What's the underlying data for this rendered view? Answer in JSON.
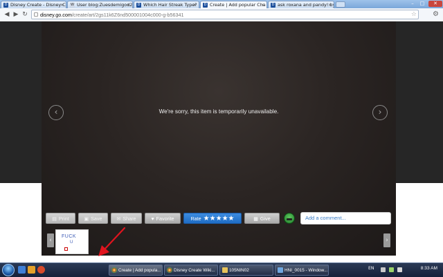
{
  "browser": {
    "tabs": [
      {
        "label": "Disney Create - Disney Cr",
        "icon": "disney-icon",
        "active": false
      },
      {
        "label": "User blog:Zuesdemigod2",
        "icon": "wiki-icon",
        "active": false
      },
      {
        "label": "Which Hair Streak Type? ·",
        "icon": "disney-icon",
        "active": false
      },
      {
        "label": "Create | Add popular Cha",
        "icon": "disney-icon",
        "active": true
      },
      {
        "label": "ask roxana and pandy! by",
        "icon": "disney-icon",
        "active": false
      }
    ],
    "url_host": "disney.go.com",
    "url_path": "/create/art/2gs11k6Z6nd500001004c000-g-b56341"
  },
  "viewer": {
    "message": "We're sorry, this item is temporarily unavailable."
  },
  "actions": {
    "print": "Print",
    "save": "Save",
    "share": "Share",
    "favorite": "Favorite",
    "rate": "Rate",
    "stars": "★★★★★",
    "give": "Give",
    "comment_placeholder": "Add a comment..."
  },
  "thumbnail": {
    "line1": "FUCK",
    "line2": "U"
  },
  "taskbar": {
    "items": [
      {
        "label": "Create | Add popula...",
        "active": true
      },
      {
        "label": "Disney Create Wiki...",
        "active": false
      },
      {
        "label": "105NIN02",
        "active": false
      },
      {
        "label": "HNI_0015 - Window...",
        "active": false
      }
    ],
    "language": "EN",
    "clock": "8:33 AM"
  },
  "colors": {
    "rate_button": "#1f6cc4",
    "comment_text": "#3a7cc6",
    "arrow": "#e0141e"
  }
}
